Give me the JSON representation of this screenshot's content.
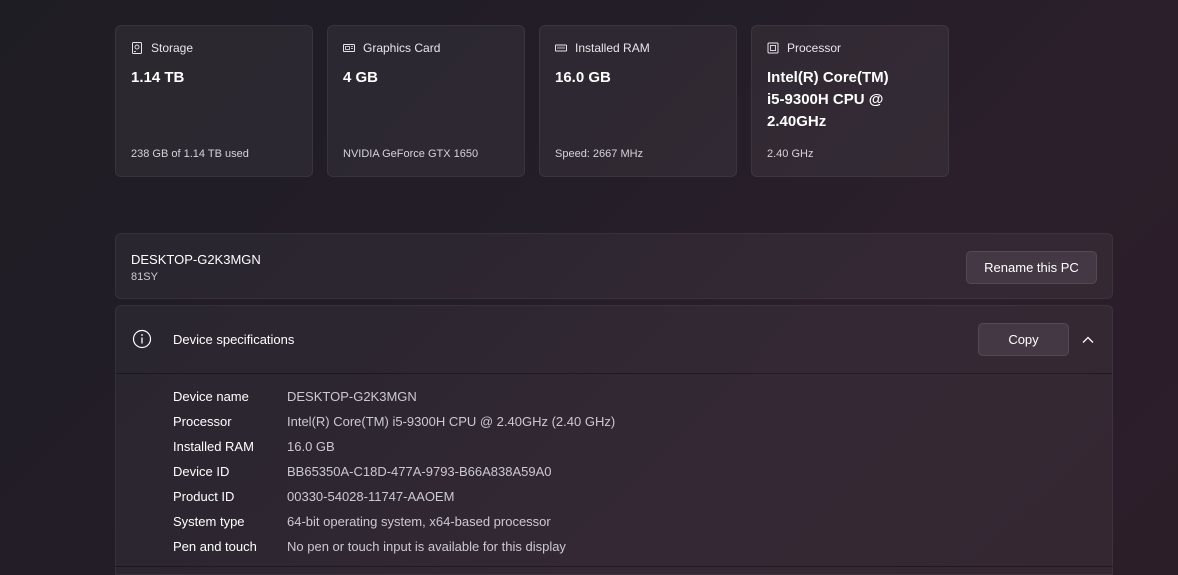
{
  "cards": [
    {
      "title": "Storage",
      "icon": "storage-icon",
      "value": "1.14 TB",
      "footer": "238 GB of 1.14 TB used"
    },
    {
      "title": "Graphics Card",
      "icon": "graphics-card-icon",
      "value": "4 GB",
      "footer": "NVIDIA GeForce GTX 1650"
    },
    {
      "title": "Installed RAM",
      "icon": "ram-icon",
      "value": "16.0 GB",
      "footer": "Speed: 2667 MHz"
    },
    {
      "title": "Processor",
      "icon": "processor-icon",
      "value": "Intel(R) Core(TM) i5-9300H CPU @ 2.40GHz",
      "footer": "2.40 GHz"
    }
  ],
  "pc": {
    "name": "DESKTOP-G2K3MGN",
    "model": "81SY",
    "rename_label": "Rename this PC"
  },
  "specs": {
    "title": "Device specifications",
    "copy_label": "Copy",
    "icon": "info-icon",
    "expanded_icon": "chevron-up-icon",
    "rows": [
      {
        "label": "Device name",
        "value": "DESKTOP-G2K3MGN"
      },
      {
        "label": "Processor",
        "value": "Intel(R) Core(TM) i5-9300H CPU @ 2.40GHz (2.40 GHz)"
      },
      {
        "label": "Installed RAM",
        "value": "16.0 GB"
      },
      {
        "label": "Device ID",
        "value": "BB65350A-C18D-477A-9793-B66A838A59A0"
      },
      {
        "label": "Product ID",
        "value": "00330-54028-11747-AAOEM"
      },
      {
        "label": "System type",
        "value": "64-bit operating system, x64-based processor"
      },
      {
        "label": "Pen and touch",
        "value": "No pen or touch input is available for this display"
      }
    ]
  }
}
